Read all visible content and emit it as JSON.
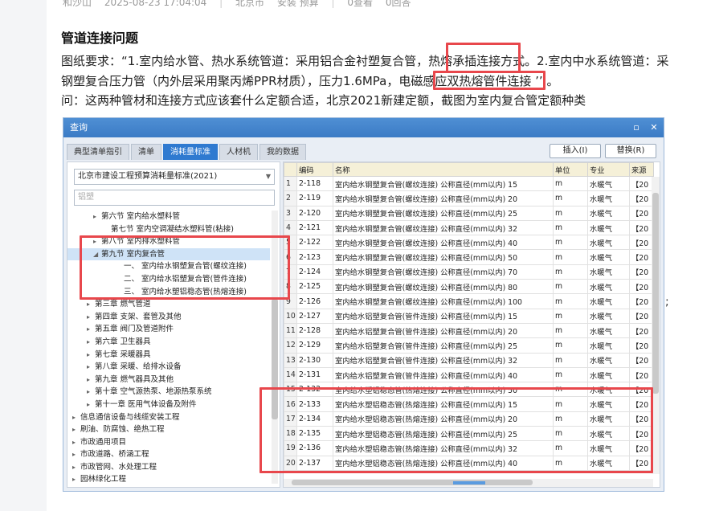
{
  "post": {
    "author": "和沙山",
    "datetime": "2025-08-23 17:04:04",
    "location": "北京市",
    "category": "安装 预算",
    "views": "0查看",
    "replies": "0回答",
    "title": "管道连接问题",
    "lines": [
      "图纸要求：“1.室内给水管、热水系统管道：采用铝合金衬塑复合管，热熔承插连接方式。2.室内中水系统管道：采",
      "钢塑复合压力管（内外层采用聚丙烯PPR材质），压力1.6MPa，电磁感应双热熔管件连接 ’’ 。",
      "问：这两种管材和连接方式应该套什么定额合适，北京2021新建定额，截图为室内复合管定额种类"
    ],
    "trailing": ";"
  },
  "dialog": {
    "title": "查询",
    "tabs": [
      "典型清单指引",
      "清单",
      "消耗量标准",
      "人材机",
      "我的数据"
    ],
    "insert_button": "插入(I)",
    "replace_button": "替换(R)",
    "standard_select": "北京市建设工程预算消耗量标准(2021)",
    "search_value": "铝塑",
    "tree": [
      {
        "label": "第六节 室内给水塑料管",
        "indent": 44,
        "arrow": "▸",
        "selected": false
      },
      {
        "label": "第七节 室内空调凝结水塑料管(粘接)",
        "indent": 54,
        "arrow": "",
        "selected": false
      },
      {
        "label": "第八节 室内排水塑料管",
        "indent": 44,
        "arrow": "▸",
        "selected": false
      },
      {
        "label": "第九节 室内复合管",
        "indent": 44,
        "arrow": "◢",
        "selected": true
      },
      {
        "label": "一、 室内给水钢塑复合管(螺纹连接)",
        "indent": 70,
        "arrow": "",
        "selected": false
      },
      {
        "label": "二、 室内给水铝塑复合管(管件连接)",
        "indent": 70,
        "arrow": "",
        "selected": false
      },
      {
        "label": "三、 室内给水塑铝稳态管(热熔连接)",
        "indent": 70,
        "arrow": "",
        "selected": false
      },
      {
        "label": "第三章 燃气管道",
        "indent": 36,
        "arrow": "▸",
        "selected": false
      },
      {
        "label": "第四章 支架、套管及其他",
        "indent": 36,
        "arrow": "▸",
        "selected": false
      },
      {
        "label": "第五章 阀门及管道附件",
        "indent": 36,
        "arrow": "▸",
        "selected": false
      },
      {
        "label": "第六章 卫生器具",
        "indent": 36,
        "arrow": "▸",
        "selected": false
      },
      {
        "label": "第七章 采暖器具",
        "indent": 36,
        "arrow": "▸",
        "selected": false
      },
      {
        "label": "第八章 采暖、给排水设备",
        "indent": 36,
        "arrow": "▸",
        "selected": false
      },
      {
        "label": "第九章 燃气器具及其他",
        "indent": 36,
        "arrow": "▸",
        "selected": false
      },
      {
        "label": "第十章 空气源热泵、地源热泵系统",
        "indent": 36,
        "arrow": "▸",
        "selected": false
      },
      {
        "label": "第十一章 医用气体设备及附件",
        "indent": 36,
        "arrow": "▸",
        "selected": false
      },
      {
        "label": "信息通信设备与线缆安装工程",
        "indent": 18,
        "arrow": "▸",
        "selected": false
      },
      {
        "label": "刷油、防腐蚀、绝热工程",
        "indent": 18,
        "arrow": "▸",
        "selected": false
      },
      {
        "label": "市政通用项目",
        "indent": 18,
        "arrow": "▸",
        "selected": false
      },
      {
        "label": "市政道路、桥涵工程",
        "indent": 18,
        "arrow": "▸",
        "selected": false
      },
      {
        "label": "市政管网、水处理工程",
        "indent": 18,
        "arrow": "▸",
        "selected": false
      },
      {
        "label": "园林绿化工程",
        "indent": 18,
        "arrow": "▸",
        "selected": false
      }
    ],
    "columns": [
      "",
      "编码",
      "名称",
      "单位",
      "专业",
      "来源"
    ],
    "rows": [
      [
        "1",
        "2-118",
        "室内给水钢塑复合管(螺纹连接) 公称直径(mm以内) 15",
        "m",
        "水暖气",
        "【20"
      ],
      [
        "2",
        "2-119",
        "室内给水钢塑复合管(螺纹连接) 公称直径(mm以内) 20",
        "m",
        "水暖气",
        "【20"
      ],
      [
        "3",
        "2-120",
        "室内给水钢塑复合管(螺纹连接) 公称直径(mm以内) 25",
        "m",
        "水暖气",
        "【20"
      ],
      [
        "4",
        "2-121",
        "室内给水钢塑复合管(螺纹连接) 公称直径(mm以内) 32",
        "m",
        "水暖气",
        "【20"
      ],
      [
        "5",
        "2-122",
        "室内给水钢塑复合管(螺纹连接) 公称直径(mm以内) 40",
        "m",
        "水暖气",
        "【20"
      ],
      [
        "6",
        "2-123",
        "室内给水钢塑复合管(螺纹连接) 公称直径(mm以内) 50",
        "m",
        "水暖气",
        "【20"
      ],
      [
        "7",
        "2-124",
        "室内给水钢塑复合管(螺纹连接) 公称直径(mm以内) 70",
        "m",
        "水暖气",
        "【20"
      ],
      [
        "8",
        "2-125",
        "室内给水钢塑复合管(螺纹连接) 公称直径(mm以内) 80",
        "m",
        "水暖气",
        "【20"
      ],
      [
        "9",
        "2-126",
        "室内给水钢塑复合管(螺纹连接) 公称直径(mm以内) 100",
        "m",
        "水暖气",
        "【20"
      ],
      [
        "10",
        "2-127",
        "室内给水铝塑复合管(管件连接) 公称直径(mm以内) 15",
        "m",
        "水暖气",
        "【20"
      ],
      [
        "11",
        "2-128",
        "室内给水铝塑复合管(管件连接) 公称直径(mm以内) 20",
        "m",
        "水暖气",
        "【20"
      ],
      [
        "12",
        "2-129",
        "室内给水铝塑复合管(管件连接) 公称直径(mm以内) 25",
        "m",
        "水暖气",
        "【20"
      ],
      [
        "13",
        "2-130",
        "室内给水铝塑复合管(管件连接) 公称直径(mm以内) 32",
        "m",
        "水暖气",
        "【20"
      ],
      [
        "14",
        "2-131",
        "室内给水铝塑复合管(管件连接) 公称直径(mm以内) 40",
        "m",
        "水暖气",
        "【20"
      ],
      [
        "15",
        "2-132",
        "室内给水塑铝稳态管(热熔连接) 公称直径(mm以内) 50",
        "m",
        "水暖气",
        "【20"
      ],
      [
        "16",
        "2-133",
        "室内给水塑铝稳态管(热熔连接) 公称直径(mm以内) 15",
        "m",
        "水暖气",
        "【20"
      ],
      [
        "17",
        "2-134",
        "室内给水塑铝稳态管(热熔连接) 公称直径(mm以内) 20",
        "m",
        "水暖气",
        "【20"
      ],
      [
        "18",
        "2-135",
        "室内给水塑铝稳态管(热熔连接) 公称直径(mm以内) 25",
        "m",
        "水暖气",
        "【20"
      ],
      [
        "19",
        "2-136",
        "室内给水塑铝稳态管(热熔连接) 公称直径(mm以内) 32",
        "m",
        "水暖气",
        "【20"
      ],
      [
        "20",
        "2-137",
        "室内给水塑铝稳态管(热熔连接) 公称直径(mm以内) 40",
        "m",
        "水暖气",
        "【20"
      ]
    ]
  },
  "colors": {
    "highlight": "#e8474c",
    "title_bar": "#3b7bc5",
    "active_tab": "#2f7ad0"
  }
}
